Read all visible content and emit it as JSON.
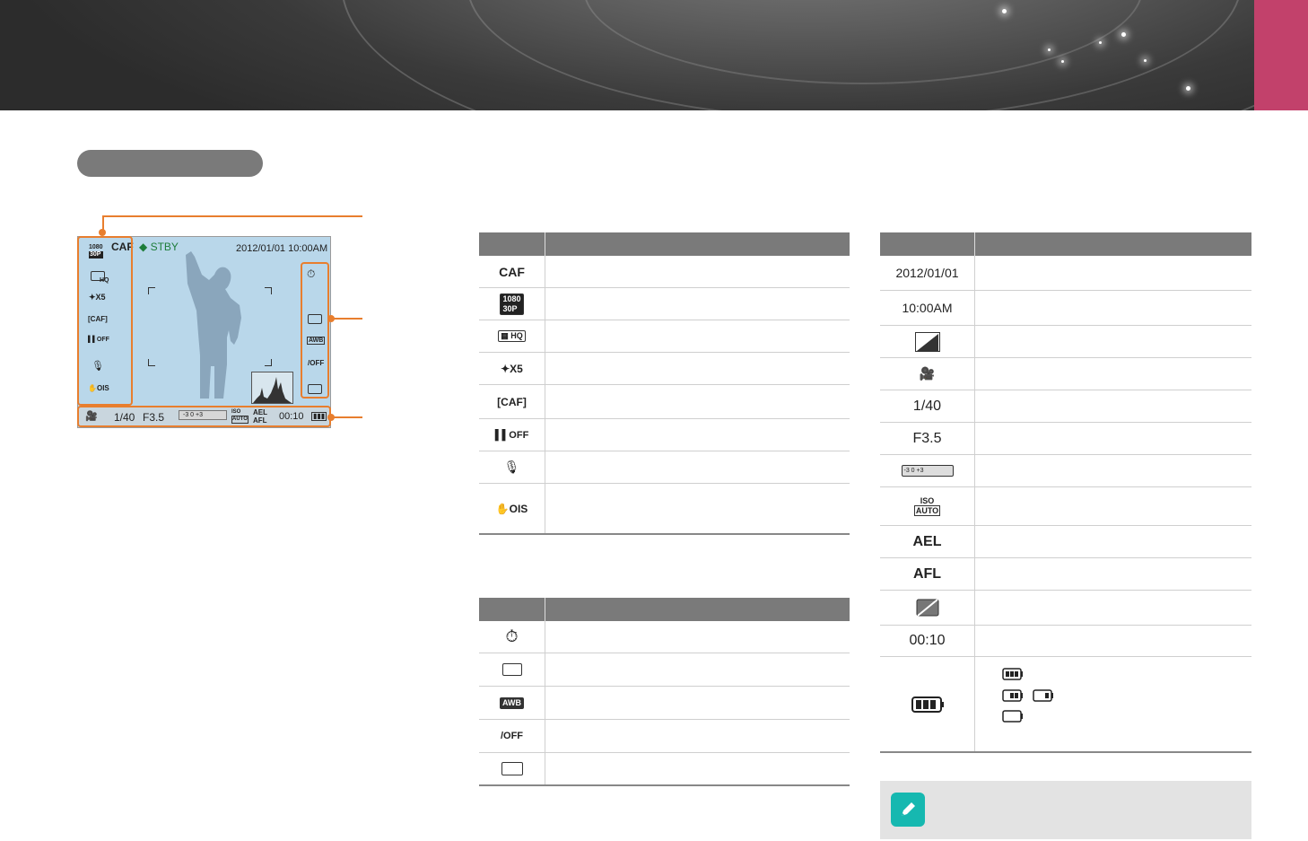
{
  "screen": {
    "caf": "CAF",
    "stby": "STBY",
    "datetime": "2012/01/01 10:00AM",
    "shutter": "1/40",
    "aperture": "F3.5",
    "iso_top": "ISO",
    "iso_bottom": "AUTO",
    "ael": "AEL",
    "afl": "AFL",
    "elapsed": "00:10",
    "quality_tag": "HQ",
    "zoom_tag": "X5",
    "off_tag": "OFF",
    "ois_tag": "OIS",
    "res_top": "1080",
    "res_bottom": "30P",
    "exposure_scale": "-3 0 +3"
  },
  "table_left_top": {
    "rows": [
      {
        "icon": "CAF",
        "name": "caf-icon"
      },
      {
        "icon": "1080 30P",
        "name": "resolution-icon"
      },
      {
        "icon": "HQ",
        "name": "quality-icon"
      },
      {
        "icon": "X5",
        "name": "smart-zoom-icon"
      },
      {
        "icon": "CAF",
        "name": "focus-area-icon"
      },
      {
        "icon": "OFF",
        "name": "wind-cut-off-icon"
      },
      {
        "icon": "mic",
        "name": "microphone-icon"
      },
      {
        "icon": "OIS",
        "name": "ois-icon"
      }
    ]
  },
  "table_left_bottom": {
    "rows": [
      {
        "icon": "timer",
        "name": "timer-icon"
      },
      {
        "icon": "metering",
        "name": "metering-icon"
      },
      {
        "icon": "AWB",
        "name": "awb-icon"
      },
      {
        "icon": "OFF",
        "name": "flash-off-icon"
      },
      {
        "icon": "picture-wizard",
        "name": "picture-wizard-icon"
      }
    ]
  },
  "table_right": {
    "rows": [
      {
        "text": "2012/01/01",
        "name": "date-text"
      },
      {
        "text": "10:00AM",
        "name": "time-text"
      },
      {
        "icon": "histogram",
        "name": "histogram-icon"
      },
      {
        "icon": "movie-p",
        "name": "movie-mode-icon"
      },
      {
        "text": "1/40",
        "name": "shutter-text"
      },
      {
        "text": "F3.5",
        "name": "aperture-text"
      },
      {
        "icon": "exposure-scale",
        "name": "exposure-scale-icon"
      },
      {
        "icon": "ISO AUTO",
        "name": "iso-auto-icon"
      },
      {
        "text": "AEL",
        "name": "ael-text"
      },
      {
        "text": "AFL",
        "name": "afl-text"
      },
      {
        "icon": "no-card",
        "name": "memory-card-icon"
      },
      {
        "text": "00:10",
        "name": "recording-time-text"
      },
      {
        "icon": "battery",
        "name": "battery-icon"
      }
    ]
  },
  "colors": {
    "accent_orange": "#e87e2e",
    "header_gray": "#7a7a7a",
    "tab_pink": "#c2416b",
    "note_icon": "#16b8b0"
  }
}
